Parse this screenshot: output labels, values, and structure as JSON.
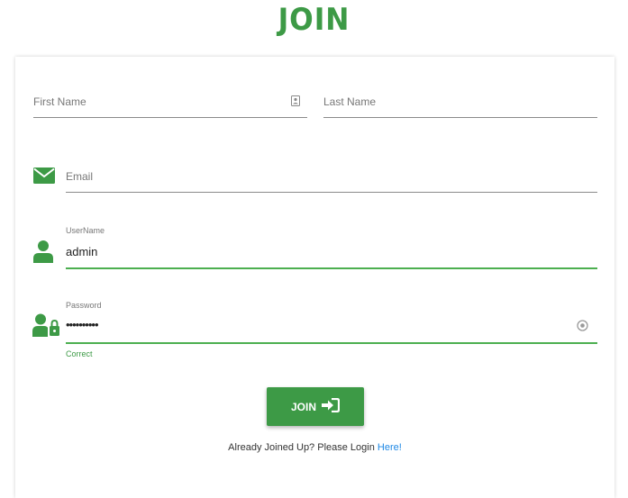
{
  "page": {
    "title": "JOIN"
  },
  "form": {
    "first_name": {
      "placeholder": "First Name",
      "value": ""
    },
    "last_name": {
      "placeholder": "Last Name",
      "value": ""
    },
    "email": {
      "placeholder": "Email",
      "value": ""
    },
    "username": {
      "label": "UserName",
      "value": "admin"
    },
    "password": {
      "label": "Password",
      "value": "••••••••••",
      "helper": "Correct"
    }
  },
  "actions": {
    "join_label": "JOIN",
    "join_icon": "sign-in-icon"
  },
  "footer": {
    "text": "Already Joined Up? Please Login ",
    "link": "Here!"
  },
  "colors": {
    "accent": "#3d9a46",
    "underline_active": "#4caf50",
    "link": "#1e88e5"
  },
  "icons": {
    "first_name": "contact-card-icon",
    "email": "envelope-icon",
    "username": "user-icon",
    "password": "user-lock-icon",
    "password_toggle": "eye-icon"
  }
}
